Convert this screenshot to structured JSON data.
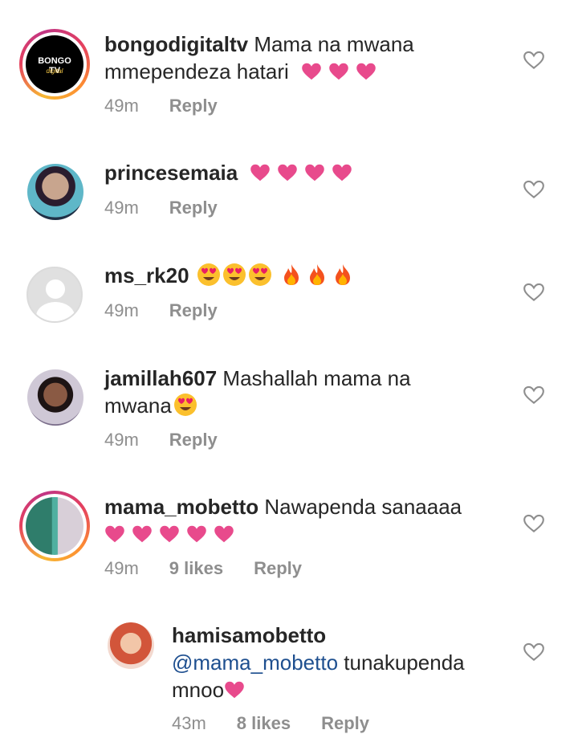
{
  "comments": [
    {
      "username": "bongodigitaltv",
      "text": " Mama na mwana",
      "text2": "mmependeza hatari",
      "time": "49m",
      "reply": "Reply",
      "avatar_text": "BONGO TV",
      "avatar_sub": "digital"
    },
    {
      "username": "princesemaia",
      "time": "49m",
      "reply": "Reply"
    },
    {
      "username": "ms_rk20",
      "time": "49m",
      "reply": "Reply"
    },
    {
      "username": "jamillah607",
      "text": " Mashallah mama na",
      "text2": "mwana",
      "time": "49m",
      "reply": "Reply"
    },
    {
      "username": "mama_mobetto",
      "text": " Nawapenda sanaaaa",
      "time": "49m",
      "likes": "9 likes",
      "reply": "Reply"
    },
    {
      "username": "hamisamobetto",
      "mention": "@mama_mobetto",
      "text": " tunakupenda",
      "text2": "mnoo",
      "time": "43m",
      "likes": "8 likes",
      "reply": "Reply"
    }
  ],
  "colors": {
    "heart_pink": "#e84a8c",
    "meta_gray": "#8e8e8e",
    "mention_blue": "#1e4f8f"
  }
}
